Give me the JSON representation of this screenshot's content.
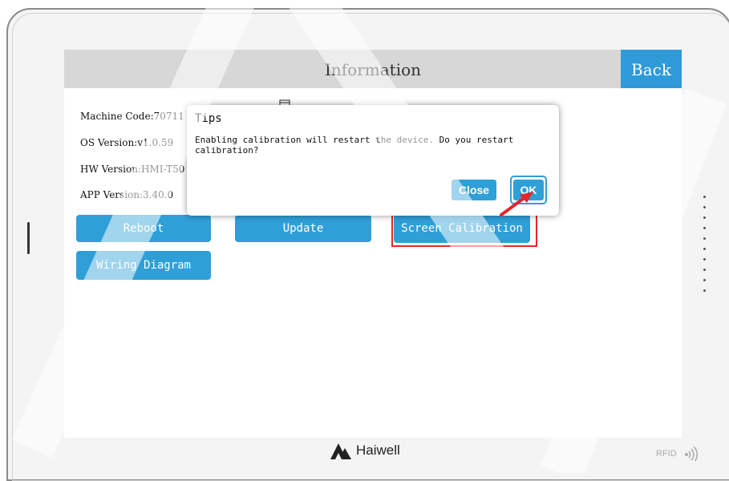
{
  "header": {
    "title": "Information",
    "back_label": "Back"
  },
  "info": {
    "machine_code": "Machine Code:70711",
    "os_version": "OS Version:v1.0.59",
    "hw_version": "HW Version:HMI-T50",
    "app_version": "APP Version:3.40.0"
  },
  "buttons": {
    "reboot": "Reboot",
    "update": "Update",
    "screen_calibration": "Screen Calibration",
    "wiring_diagram": "Wiring Diagram"
  },
  "dialog": {
    "title": "Tips",
    "message": "Enabling calibration will restart the device. Do you restart calibration?",
    "close_label": "Close",
    "ok_label": "OK"
  },
  "footer": {
    "brand": "Haiwell",
    "rfid": "RFID"
  },
  "colors": {
    "accent": "#2f9fd8",
    "highlight": "#e4262b",
    "titlebar": "#d7d7d7"
  }
}
